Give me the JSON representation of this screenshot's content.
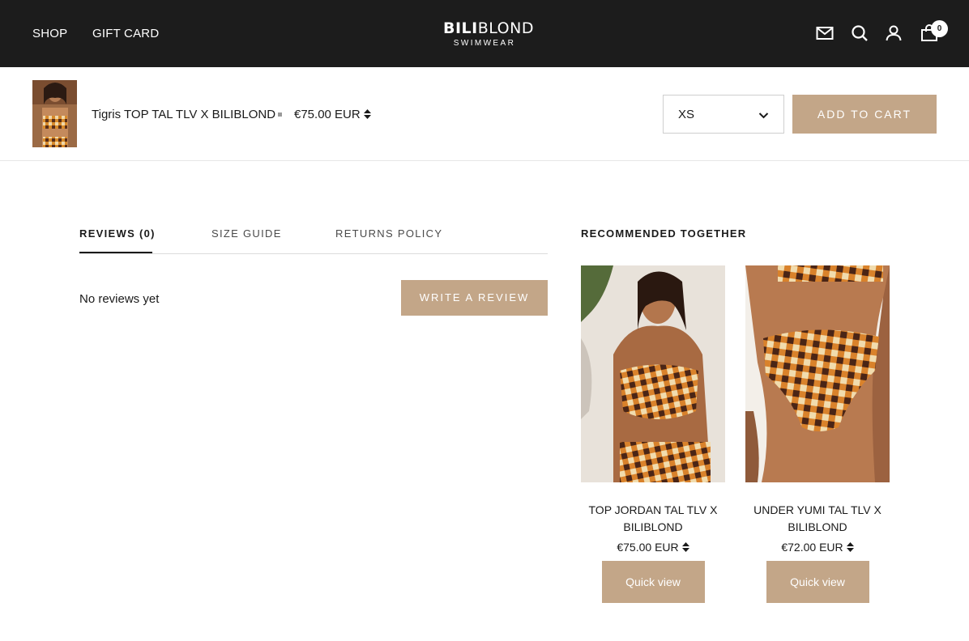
{
  "header": {
    "nav": [
      "SHOP",
      "GIFT CARD"
    ],
    "logo_bold": "BILI",
    "logo_light": "BLOND",
    "logo_sub": "SWIMWEAR",
    "icons": [
      "mail-icon",
      "search-icon",
      "account-icon",
      "cart-icon"
    ],
    "cart_count": "0"
  },
  "sticky": {
    "title": "Tigris TOP TAL TLV X BILIBLOND",
    "price": "€75.00 EUR",
    "size": "XS",
    "add_to_cart": "ADD TO CART"
  },
  "tabs": [
    {
      "label": "REVIEWS (0)",
      "active": true
    },
    {
      "label": "SIZE GUIDE",
      "active": false
    },
    {
      "label": "RETURNS POLICY",
      "active": false
    }
  ],
  "reviews": {
    "empty_text": "No reviews yet",
    "write_button": "WRITE A REVIEW"
  },
  "recommended": {
    "heading": "RECOMMENDED TOGETHER",
    "items": [
      {
        "title": "TOP JORDAN TAL TLV X BILIBLOND",
        "price": "€75.00 EUR",
        "button": "Quick view"
      },
      {
        "title": "UNDER YUMI TAL TLV X BILIBLOND",
        "price": "€72.00 EUR",
        "button": "Quick view"
      }
    ]
  },
  "colors": {
    "header_bg": "#1c1c1c",
    "accent": "#c3a688",
    "text": "#1a1a1a"
  }
}
